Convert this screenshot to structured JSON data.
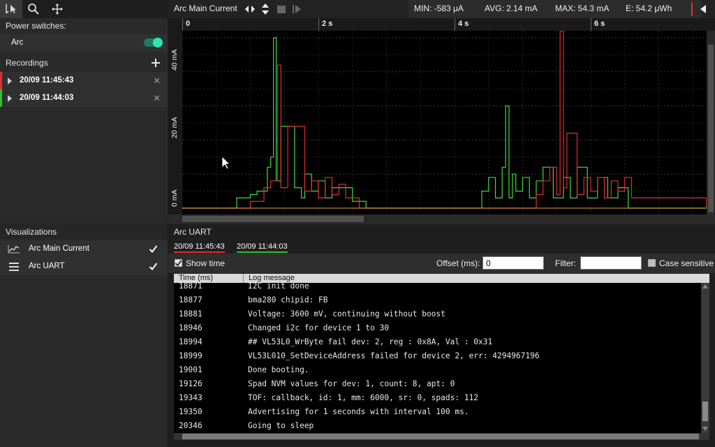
{
  "left": {
    "power_switches": {
      "title": "Power switches:",
      "items": [
        {
          "label": "Arc",
          "on": true,
          "accent": "#2ee6b3"
        }
      ]
    },
    "recordings": {
      "title": "Recordings",
      "items": [
        {
          "label": "20/09 11:45:43",
          "color": "#e03030"
        },
        {
          "label": "20/09 11:44:03",
          "color": "#30c030"
        }
      ]
    },
    "visualizations": {
      "title": "Visualizations",
      "items": [
        {
          "label": "Arc Main Current",
          "icon": "line-chart-icon",
          "checked": true
        },
        {
          "label": "Arc UART",
          "icon": "list-icon",
          "checked": true
        }
      ]
    }
  },
  "topbar": {
    "title": "Arc Main Current",
    "min": "MIN: -583 μA",
    "avg": "AVG: 2.14 mA",
    "max": "MAX: 54.3 mA",
    "energy": "E: 54.2 μWh"
  },
  "chart_data": {
    "type": "line",
    "x_ticks": [
      "0",
      "2 s",
      "4 s",
      "6 s"
    ],
    "y_ticks": [
      "0 mA",
      "20 mA",
      "40 mA"
    ],
    "xlim": [
      0,
      7.7
    ],
    "ylim": [
      -2,
      55
    ],
    "grid": true,
    "series": [
      {
        "color": "#3ddc3d",
        "x": [
          0,
          0.72,
          0.8,
          1.0,
          1.1,
          1.25,
          1.3,
          1.34,
          1.38,
          1.45,
          1.5,
          1.55,
          1.65,
          1.75,
          1.8,
          1.9,
          2.0,
          2.1,
          2.2,
          2.5,
          2.7,
          4.35,
          4.4,
          4.5,
          4.6,
          4.7,
          4.75,
          4.8,
          4.85,
          4.9,
          5.0,
          5.1,
          5.2,
          5.3,
          5.45,
          5.6,
          5.7,
          5.8,
          5.95,
          6.1,
          6.25,
          6.4,
          6.55,
          7.7
        ],
        "y": [
          0,
          0,
          3,
          4,
          5,
          12,
          15,
          50,
          8,
          24,
          24,
          24,
          6,
          3,
          10,
          5,
          8,
          3,
          6,
          2,
          0,
          0,
          5,
          9,
          3,
          12,
          30,
          3,
          10,
          5,
          9,
          3,
          8,
          12,
          3,
          9,
          3,
          12,
          3,
          9,
          3,
          6,
          0,
          0
        ]
      },
      {
        "color": "#e03030",
        "x": [
          0,
          0.9,
          1.0,
          1.2,
          1.3,
          1.4,
          1.45,
          1.55,
          1.6,
          1.7,
          1.75,
          1.8,
          1.9,
          2.0,
          2.1,
          2.2,
          2.3,
          2.4,
          2.6,
          5.1,
          5.2,
          5.3,
          5.4,
          5.5,
          5.55,
          5.6,
          5.65,
          5.7,
          5.75,
          5.8,
          5.9,
          6.0,
          6.1,
          6.2,
          6.3,
          6.4,
          6.5,
          6.6,
          7.7
        ],
        "y": [
          0,
          0,
          2,
          6,
          8,
          42,
          6,
          24,
          24,
          24,
          24,
          5,
          8,
          3,
          9,
          4,
          7,
          3,
          0,
          0,
          4,
          8,
          12,
          4,
          52,
          6,
          22,
          22,
          22,
          4,
          9,
          5,
          9,
          3,
          8,
          5,
          9,
          3,
          0
        ]
      },
      {
        "color": "#e8a030",
        "x": [
          0,
          7.7
        ],
        "y": [
          0,
          0
        ]
      }
    ]
  },
  "uart": {
    "title": "Arc UART",
    "tabs": [
      {
        "label": "20/09 11:45:43",
        "color": "#e03030"
      },
      {
        "label": "20/09 11:44:03",
        "color": "#30c030"
      }
    ],
    "show_time_label": "Show time",
    "offset_label": "Offset (ms):",
    "offset_value": "0",
    "filter_label": "Filter:",
    "filter_value": "",
    "case_label": "Case sensitive",
    "col_time": "Time (ms)",
    "col_msg": "Log message",
    "rows": [
      {
        "t": "18871",
        "m": "I2C init done"
      },
      {
        "t": "18877",
        "m": "bma280 chipid: FB"
      },
      {
        "t": "18881",
        "m": "Voltage: 3600 mV, continuing without boost"
      },
      {
        "t": "18946",
        "m": "Changed i2c for device 1 to 30"
      },
      {
        "t": "18994",
        "m": "## VL53L0_WrByte fail dev: 2, reg : 0x8A, Val : 0x31"
      },
      {
        "t": "18999",
        "m": "VL53L010_SetDeviceAddress failed for device 2, err: 4294967196"
      },
      {
        "t": "19001",
        "m": "Done booting."
      },
      {
        "t": "19126",
        "m": "Spad NVM values for dev: 1, count: 8, apt: 0"
      },
      {
        "t": "19343",
        "m": "TOF: callback, id: 1, mm: 6000, sr: 0, spads: 112"
      },
      {
        "t": "19350",
        "m": "Advertising for 1 seconds with interval 100 ms."
      },
      {
        "t": "20346",
        "m": "Going to sleep"
      }
    ]
  }
}
